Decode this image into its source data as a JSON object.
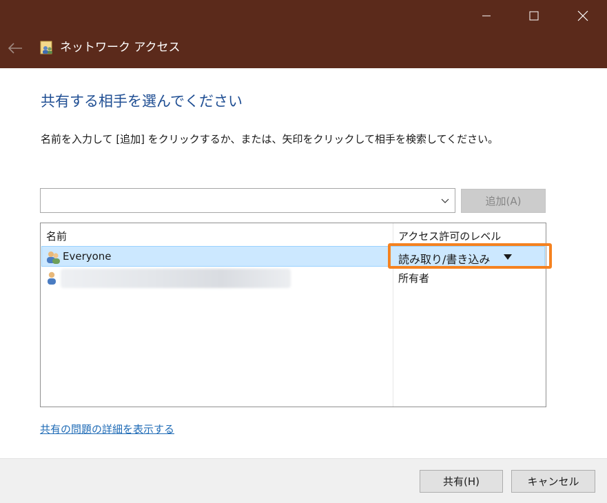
{
  "window": {
    "title": "ネットワーク アクセス"
  },
  "heading": "共有する相手を選んでください",
  "instruction": "名前を入力して [追加] をクリックするか、または、矢印をクリックして相手を検索してください。",
  "name_input": {
    "value": "",
    "placeholder": ""
  },
  "add_button": {
    "label": "追加(A)",
    "enabled": false
  },
  "list": {
    "columns": [
      "名前",
      "アクセス許可のレベル"
    ],
    "rows": [
      {
        "name": "Everyone",
        "access": "読み取り/書き込み",
        "selected": true,
        "icon": "group-icon"
      },
      {
        "name": "",
        "access": "所有者",
        "selected": false,
        "icon": "user-icon"
      }
    ]
  },
  "help_link": "共有の問題の詳細を表示する",
  "footer": {
    "share_label": "共有(H)",
    "cancel_label": "キャンセル"
  },
  "colors": {
    "titlebar": "#5b2a1b",
    "heading": "#1f4e93",
    "selection": "#cce8ff",
    "highlight": "#f58220",
    "link": "#1f6bb6"
  }
}
